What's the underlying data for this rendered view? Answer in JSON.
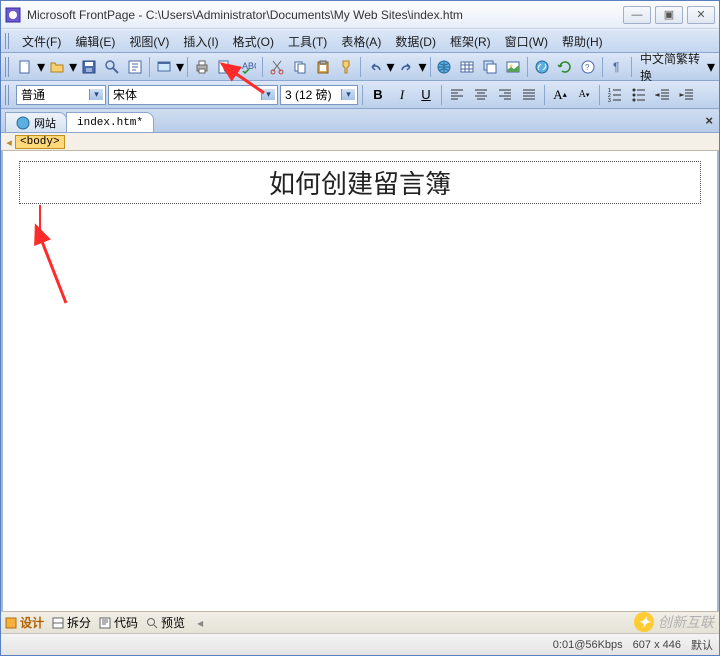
{
  "titlebar": {
    "app_name": "Microsoft FrontPage",
    "document_path": "C:\\Users\\Administrator\\Documents\\My Web Sites\\index.htm"
  },
  "window_controls": {
    "min": "—",
    "max": "▣",
    "close": "✕"
  },
  "menus": {
    "file": "文件(F)",
    "edit": "编辑(E)",
    "view": "视图(V)",
    "insert": "插入(I)",
    "format": "格式(O)",
    "tools": "工具(T)",
    "table": "表格(A)",
    "data": "数据(D)",
    "frame": "框架(R)",
    "window": "窗口(W)",
    "help": "帮助(H)"
  },
  "toolbar_labels": {
    "cn_convert": "中文简繁转换"
  },
  "format_bar": {
    "style": "普通",
    "font": "宋体",
    "size": "3 (12 磅)"
  },
  "tabs": {
    "site": "网站",
    "file": "index.htm*"
  },
  "body_tag": "<body>",
  "content": {
    "heading": "如何创建留言簿"
  },
  "view_modes": {
    "design": "设计",
    "split": "拆分",
    "code": "代码",
    "preview": "预览"
  },
  "status": {
    "speed": "0:01@56Kbps",
    "size": "607 x 446",
    "mode": "默认"
  },
  "watermark": "创新互联"
}
